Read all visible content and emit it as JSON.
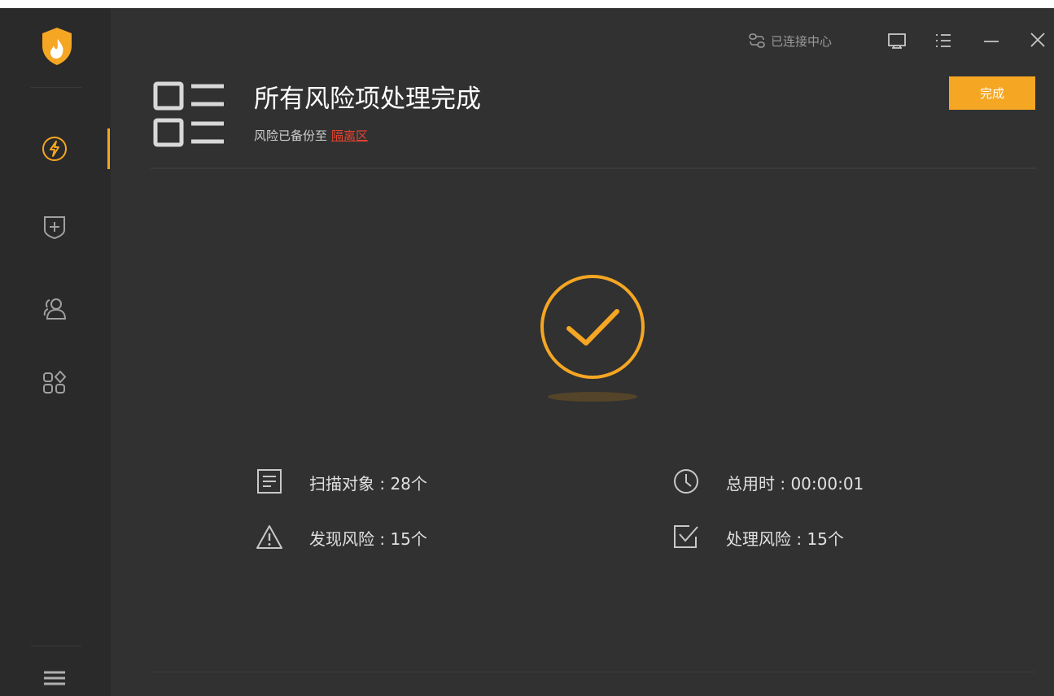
{
  "topbar": {
    "connect_label": "已连接中心",
    "connect_icon": "link-icon",
    "icons": [
      "feedback-icon",
      "menu-list-icon",
      "minimize-icon",
      "close-icon"
    ]
  },
  "sidebar": {
    "items": [
      {
        "icon": "lightning-icon",
        "active": true
      },
      {
        "icon": "shield-plus-icon",
        "active": false
      },
      {
        "icon": "users-icon",
        "active": false
      },
      {
        "icon": "apps-icon",
        "active": false
      }
    ],
    "bottom_icon": "hamburger-icon",
    "accent": "#f5a623"
  },
  "header": {
    "title": "所有风险项处理完成",
    "subtitle_prefix": "风险已备份至",
    "subtitle_link": "隔离区",
    "done_button": "完成"
  },
  "stats": {
    "scan_objects": "扫描对象 : 28个",
    "total_time": "总用时 : 00:00:01",
    "found_risks": "发现风险 : 15个",
    "handled_risks": "处理风险 : 15个"
  },
  "colors": {
    "accent": "#f5a623",
    "background": "#313131",
    "sidebar": "#2a2a2a",
    "link": "#e8432f"
  }
}
